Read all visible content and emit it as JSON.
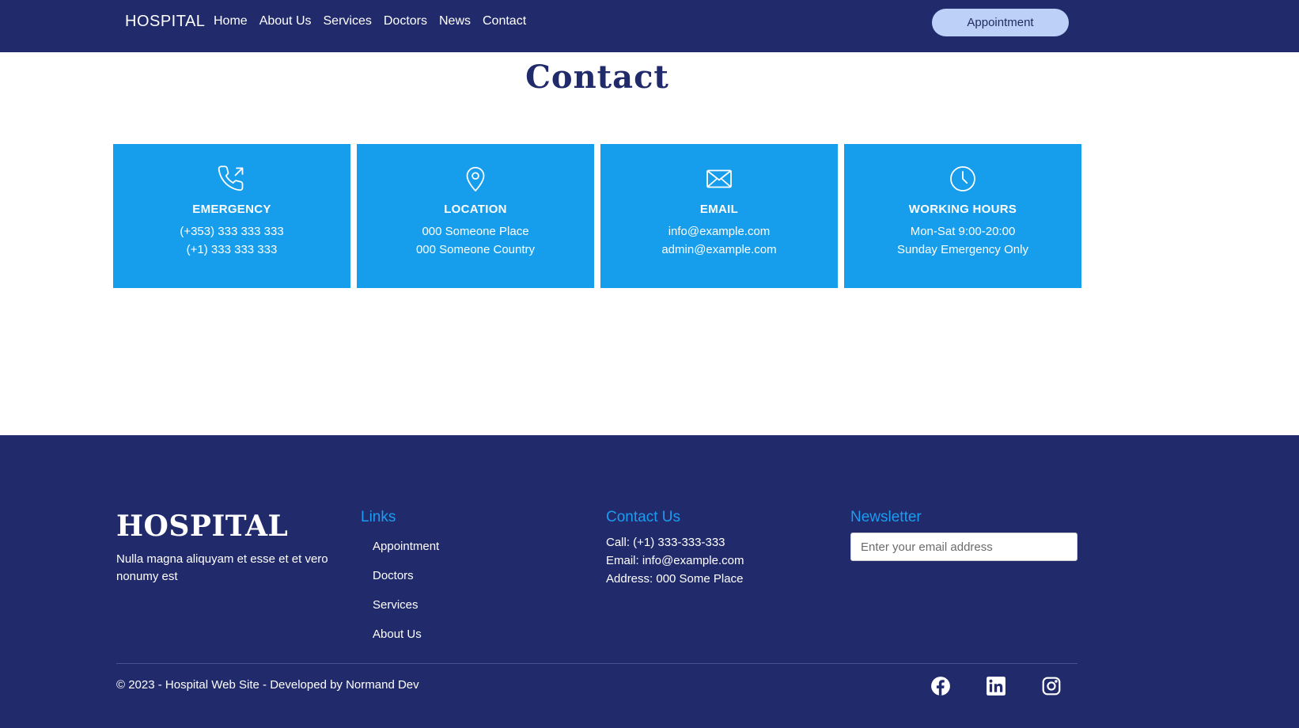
{
  "navbar": {
    "brand": "HOSPITAL",
    "links": [
      "Home",
      "About Us",
      "Services",
      "Doctors",
      "News",
      "Contact"
    ],
    "cta": "Appointment"
  },
  "page": {
    "title": "Contact"
  },
  "cards": [
    {
      "icon": "phone-icon",
      "title": "EMERGENCY",
      "lines": [
        "(+353) 333 333 333",
        "(+1) 333 333 333"
      ]
    },
    {
      "icon": "location-pin-icon",
      "title": "LOCATION",
      "lines": [
        "000 Someone Place",
        "000 Someone Country"
      ]
    },
    {
      "icon": "envelope-icon",
      "title": "EMAIL",
      "lines": [
        "info@example.com",
        "admin@example.com"
      ]
    },
    {
      "icon": "clock-icon",
      "title": "WORKING HOURS",
      "lines": [
        "Mon-Sat 9:00-20:00",
        "Sunday Emergency Only"
      ]
    }
  ],
  "footer": {
    "brand": "HOSPITAL",
    "description": "Nulla magna aliquyam et esse et et vero nonumy est",
    "links_heading": "Links",
    "links": [
      "Appointment",
      "Doctors",
      "Services",
      "About Us"
    ],
    "contact_heading": "Contact Us",
    "contact": [
      "Call: (+1) 333-333-333",
      "Email: info@example.com",
      "Address: 000 Some Place"
    ],
    "newsletter_heading": "Newsletter",
    "newsletter_placeholder": "Enter your email address",
    "copyright": "© 2023 - Hospital Web Site - Developed by Normand Dev",
    "socials": [
      "facebook-icon",
      "linkedin-icon",
      "instagram-icon"
    ]
  },
  "colors": {
    "navy": "#212b6b",
    "card_blue": "#169deb",
    "accent_blue": "#1d9bf0",
    "button_light": "#bcd0f8"
  }
}
